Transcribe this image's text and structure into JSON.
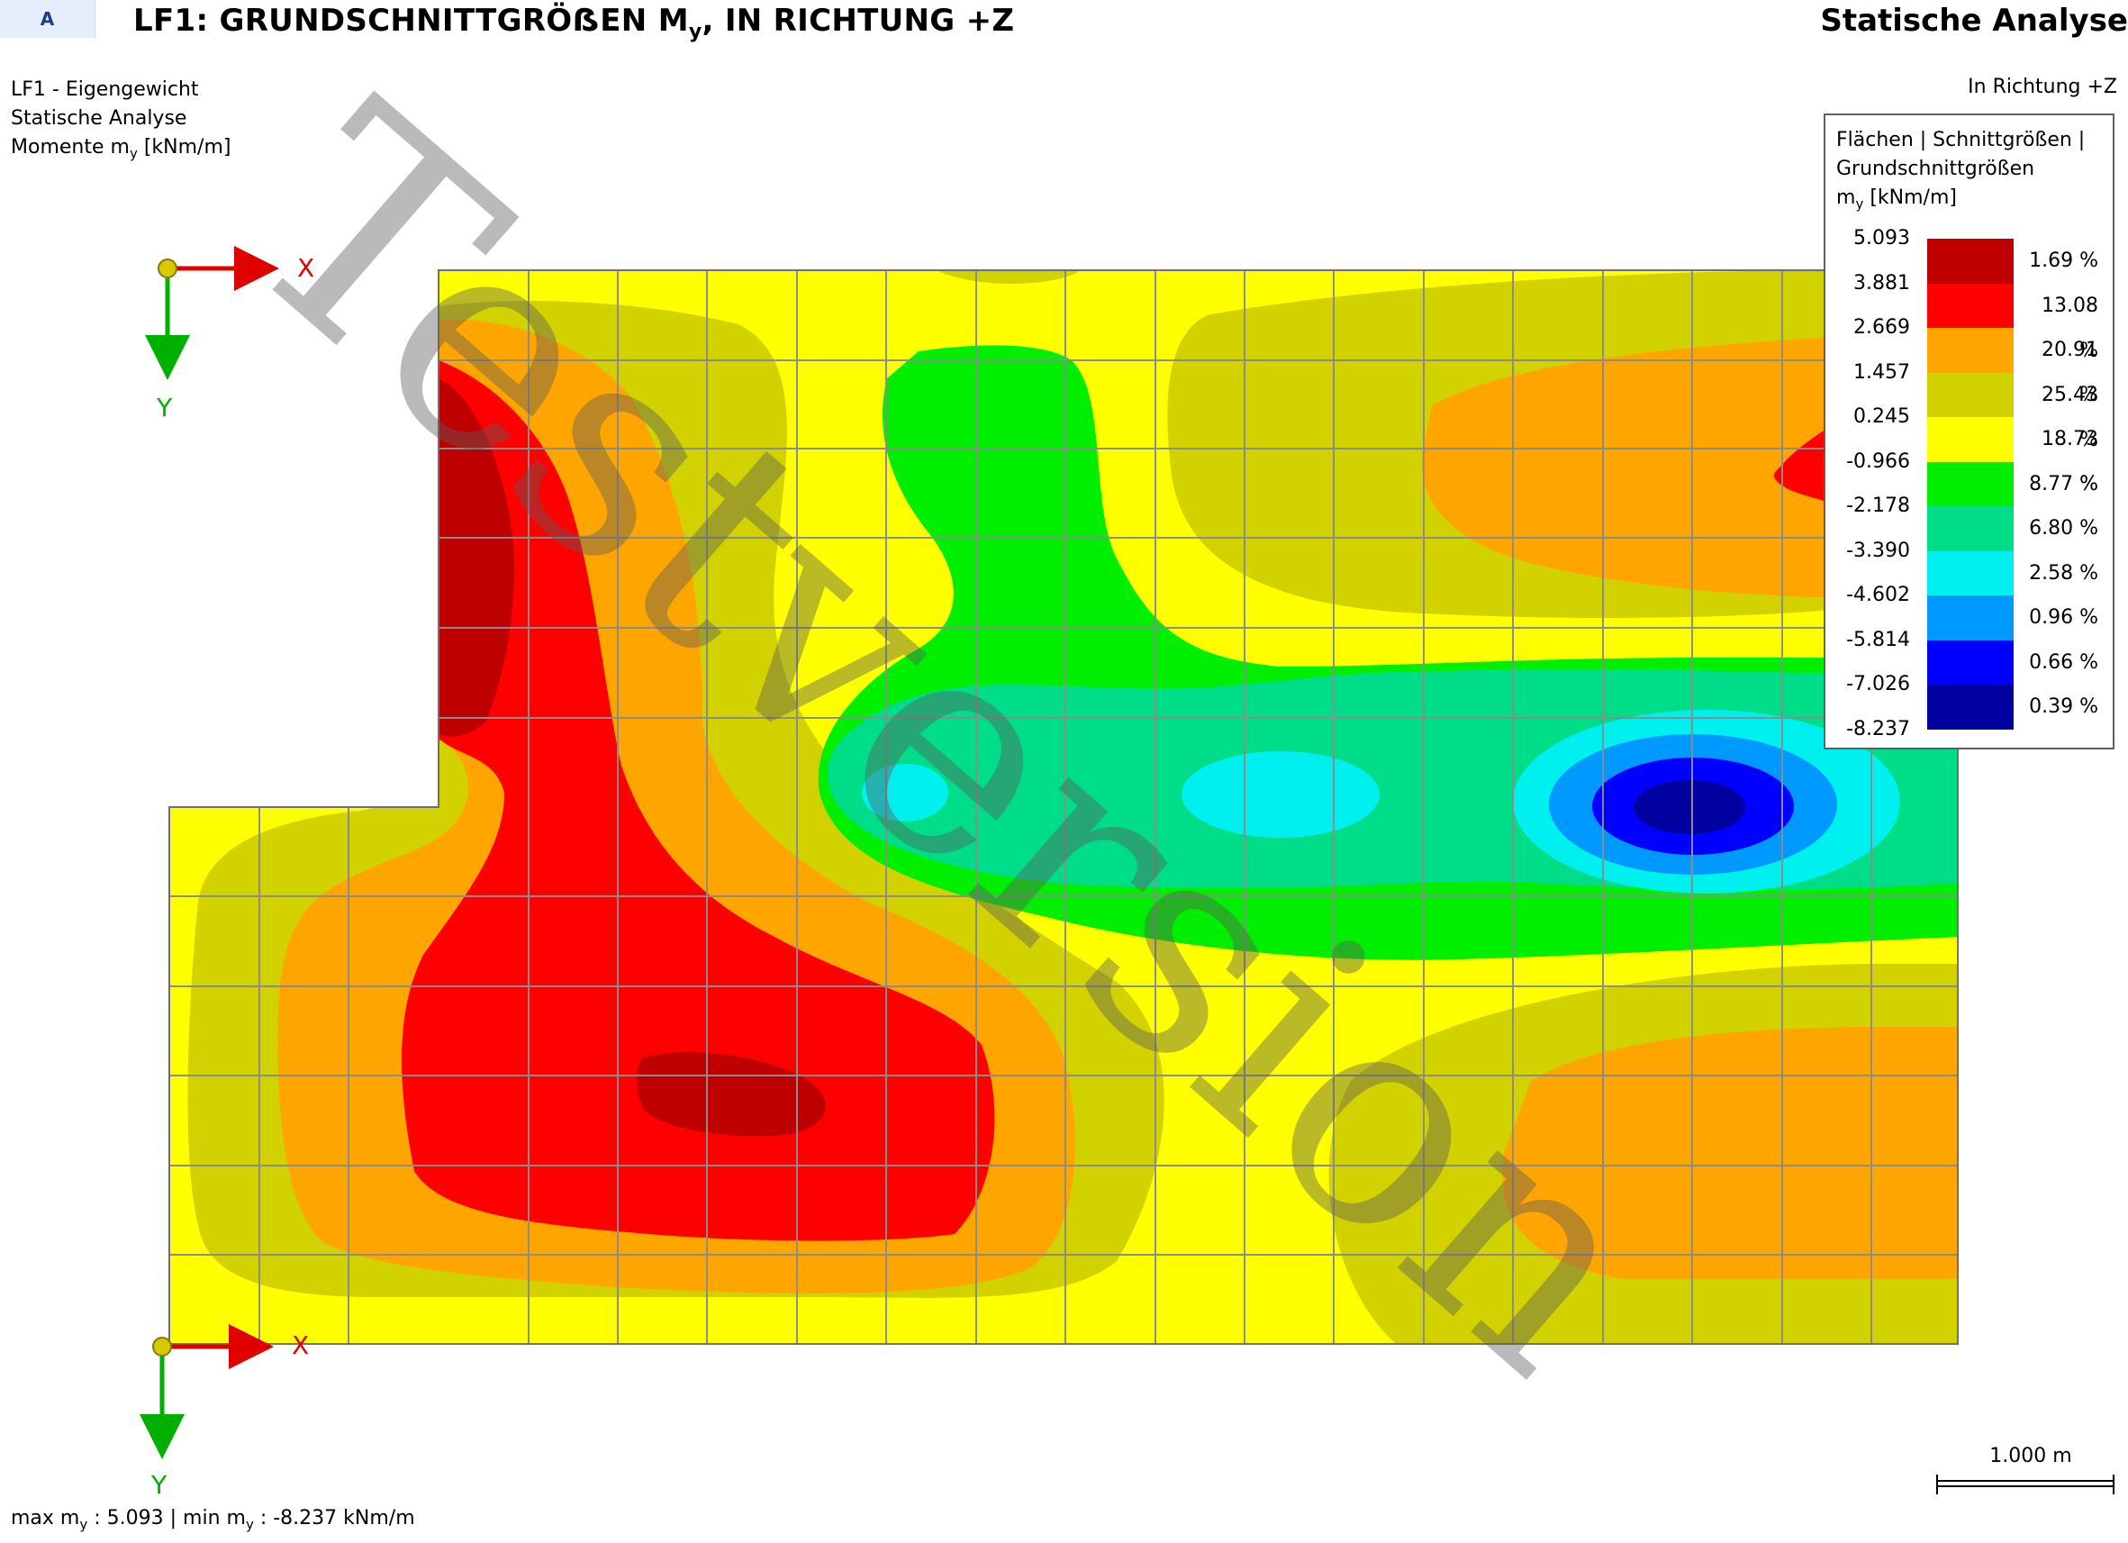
{
  "header": {
    "tab_label": "A",
    "title_prefix": "LF1: GRUNDSCHNITTGRÖẞEN M",
    "title_sub": "y",
    "title_suffix": ", IN RICHTUNG +Z",
    "analysis": "Statische Analyse"
  },
  "info": {
    "load_case": "LF1 - Eigengewicht",
    "analysis": "Statische Analyse",
    "result_prefix": "Momente m",
    "result_sub": "y",
    "result_suffix": " [kNm/m]"
  },
  "direction": "In Richtung +Z",
  "legend": {
    "title_line1": "Flächen | Schnittgrößen |",
    "title_line2": "Grundschnittgrößen",
    "unit_prefix": "m",
    "unit_sub": "y",
    "unit_suffix": " [kNm/m]",
    "ticks": [
      "5.093",
      "3.881",
      "2.669",
      "1.457",
      "0.245",
      "-0.966",
      "-2.178",
      "-3.390",
      "-4.602",
      "-5.814",
      "-7.026",
      "-8.237"
    ],
    "bands": [
      {
        "color": "#be0000",
        "percent": "1.69 %"
      },
      {
        "color": "#ff0000",
        "percent": "13.08 %"
      },
      {
        "color": "#ffa500",
        "percent": "20.91 %"
      },
      {
        "color": "#d2d200",
        "percent": "25.43 %"
      },
      {
        "color": "#ffff00",
        "percent": "18.73 %"
      },
      {
        "color": "#00ee00",
        "percent": "8.77 %"
      },
      {
        "color": "#00dd88",
        "percent": "6.80 %"
      },
      {
        "color": "#00f0f0",
        "percent": "2.58 %"
      },
      {
        "color": "#0099ff",
        "percent": "0.96 %"
      },
      {
        "color": "#0000ff",
        "percent": "0.66 %"
      },
      {
        "color": "#0000a0",
        "percent": "0.39 %"
      }
    ]
  },
  "axes": {
    "x": "X",
    "y": "Y"
  },
  "scale_label": "1.000 m",
  "footer": {
    "max_prefix": "max m",
    "max_sub": "y",
    "max_value": " : 5.093 | min m",
    "min_sub": "y",
    "min_value": " : -8.237 kNm/m"
  },
  "watermark": "Testversion"
}
